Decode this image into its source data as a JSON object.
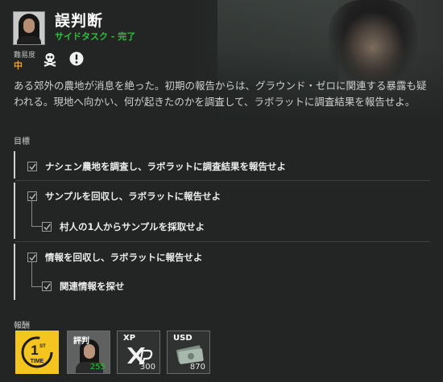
{
  "mission": {
    "title": "誤判断",
    "subtitle": "サイドタスク - 完了",
    "difficulty_label": "難易度",
    "difficulty_value": "中",
    "difficulty_icons": [
      "skull-icon",
      "exclamation-icon"
    ],
    "description": "ある郊外の農地が消息を絶った。初期の報告からは、グラウンド・ゼロに関連する暴露も疑われる。現地へ向かい、何が起きたのかを調査して、ラボラットに調査結果を報告せよ。"
  },
  "objectives": {
    "label": "目標",
    "groups": [
      {
        "text": "ナシェン農地を調査し、ラボラットに調査結果を報告せよ",
        "checked": true,
        "children": []
      },
      {
        "text": "サンプルを回収し、ラボラットに報告せよ",
        "checked": true,
        "children": [
          {
            "text": "村人の1人からサンプルを採取せよ",
            "checked": true
          }
        ]
      },
      {
        "text": "情報を回収し、ラボラットに報告せよ",
        "checked": true,
        "children": [
          {
            "text": "関連情報を探せ",
            "checked": true
          }
        ]
      }
    ]
  },
  "rewards": {
    "label": "報酬",
    "items": [
      {
        "type": "first-time",
        "icon": "first-time-icon",
        "badge_number": "1",
        "badge_suffix": "ST",
        "badge_text": "TIME"
      },
      {
        "type": "reputation",
        "label": "評判",
        "amount": "255",
        "icon": "reputation-portrait-icon"
      },
      {
        "type": "xp",
        "label": "XP",
        "amount": "300",
        "icon": "xp-icon"
      },
      {
        "type": "usd",
        "label": "USD",
        "amount": "870",
        "icon": "cash-icon"
      }
    ]
  },
  "colors": {
    "complete_green": "#2fbf3c",
    "difficulty_orange": "#f0a023",
    "first_time_yellow": "#f4c51f"
  }
}
